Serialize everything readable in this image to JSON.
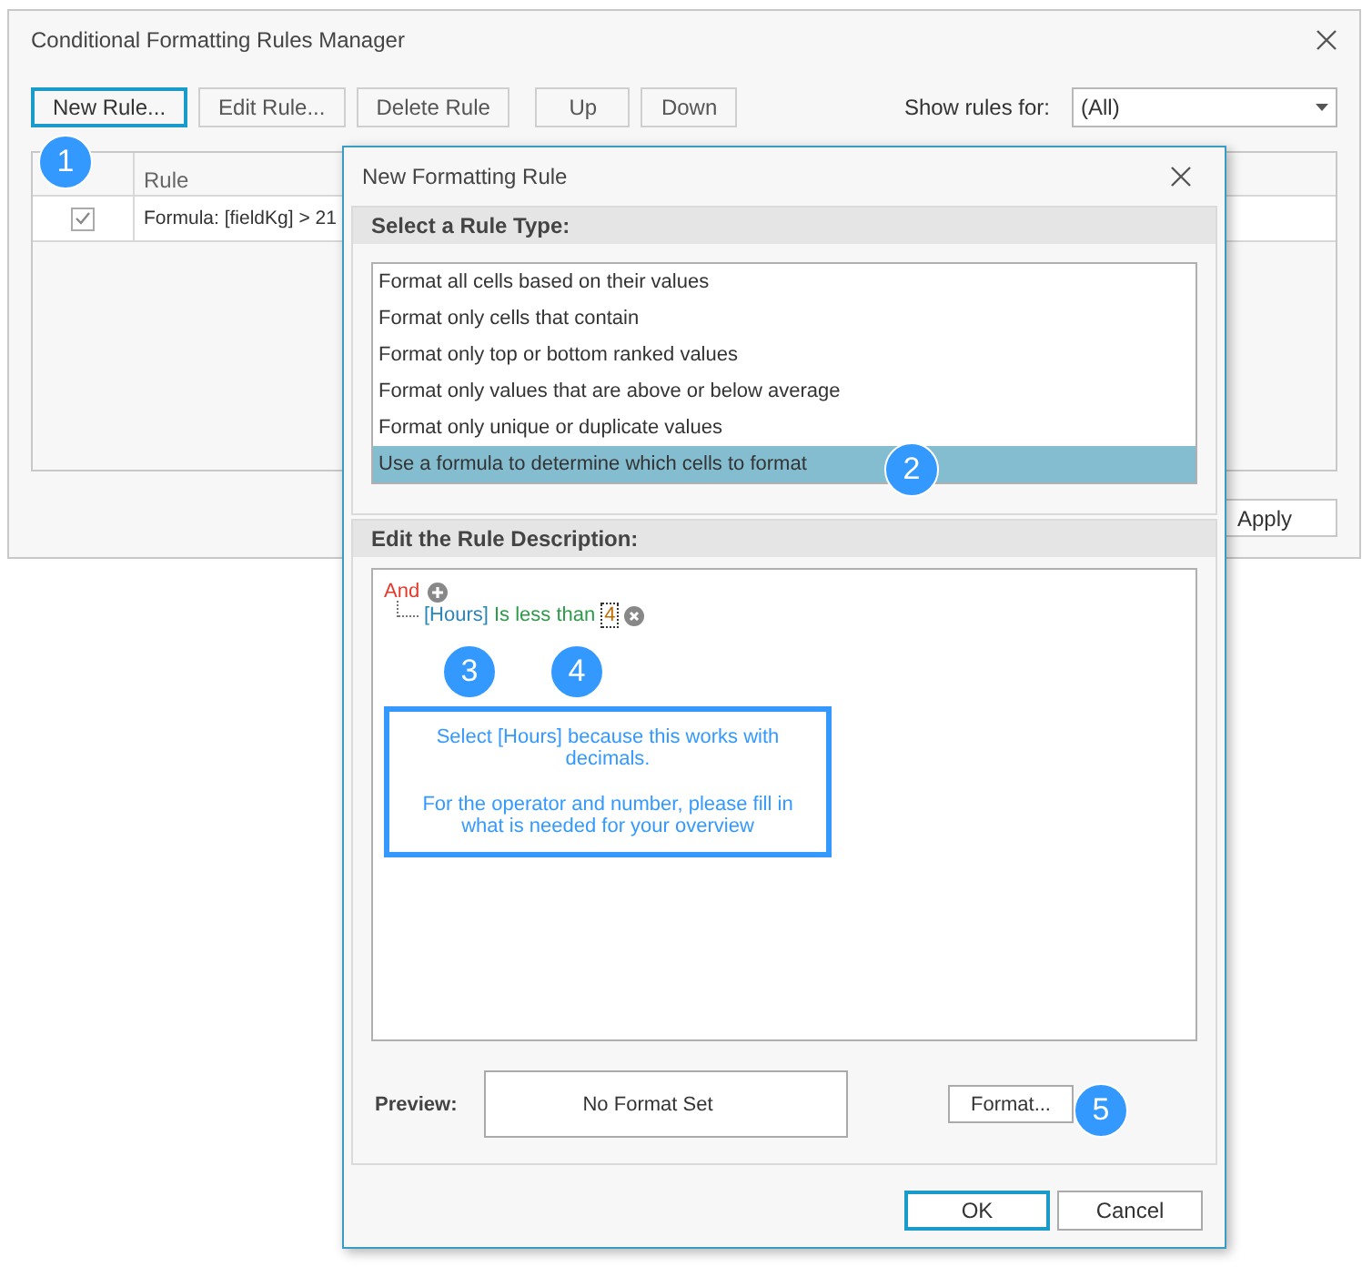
{
  "manager": {
    "title": "Conditional Formatting Rules Manager",
    "toolbar_groups": [
      [
        {
          "label": "New Rule...",
          "focused": true
        },
        {
          "label": "Edit Rule...",
          "focused": false
        },
        {
          "label": "Delete Rule",
          "focused": false
        }
      ],
      [
        {
          "label": "Up",
          "focused": false
        },
        {
          "label": "Down",
          "focused": false
        }
      ]
    ],
    "show_rules_label": "Show rules for:",
    "show_rules_value": "(All)",
    "table": {
      "columns": [
        "Rule"
      ],
      "rows": [
        {
          "checked": true,
          "rule": "Formula: [fieldKg] > 21"
        }
      ]
    },
    "apply_button": "Apply"
  },
  "dialog": {
    "title": "New Formatting Rule",
    "rule_type_heading": "Select a Rule Type:",
    "rule_types": [
      {
        "label": "Format all cells based on their values",
        "selected": false
      },
      {
        "label": "Format only cells that contain",
        "selected": false
      },
      {
        "label": "Format only top or bottom ranked values",
        "selected": false
      },
      {
        "label": "Format only values that are above or below average",
        "selected": false
      },
      {
        "label": "Format only unique or duplicate values",
        "selected": false
      },
      {
        "label": "Use a formula to determine which cells to format",
        "selected": true
      }
    ],
    "description_heading": "Edit the Rule Description:",
    "group_operator": "And",
    "condition": {
      "field": "[Hours]",
      "operator": "Is less than",
      "value": "4"
    },
    "note": [
      "Select [Hours] because this works with decimals.",
      "For the operator and number, please fill in what is needed for your overview"
    ],
    "preview_label": "Preview:",
    "preview_text": "No Format Set",
    "format_button": "Format...",
    "buttons": [
      {
        "label": "OK",
        "default": true
      },
      {
        "label": "Cancel",
        "default": false
      }
    ]
  },
  "callouts": [
    "1",
    "2",
    "3",
    "4",
    "5"
  ]
}
